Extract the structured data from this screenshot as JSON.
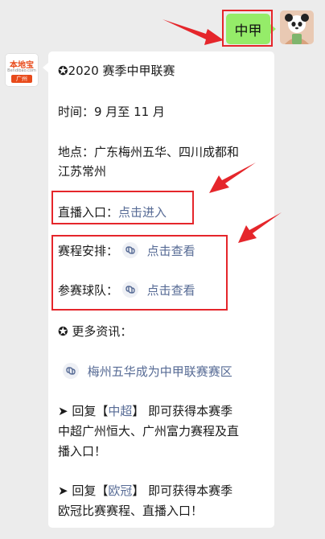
{
  "outgoing": {
    "text": "中甲"
  },
  "incoming": {
    "avatar": {
      "logo_text": "本地宝",
      "logo_sub": "Bendibao.com",
      "logo_city": "广州"
    },
    "title_star": "✪",
    "title": "2020 赛季中甲联赛",
    "time": "时间：9 月至 11 月",
    "place_line1": "地点：广东梅州五华、四川成都和",
    "place_line2": "江苏常州",
    "live_label": "直播入口：",
    "live_link": "点击进入",
    "schedule_label": "赛程安排：",
    "schedule_link": "点击查看",
    "teams_label": "参赛球队：",
    "teams_link": "点击查看",
    "more_star": "✪",
    "more_title": "更多资讯：",
    "more_link": "梅州五华成为中甲联赛赛区",
    "reply1_prefix": "➤ 回复【",
    "reply1_keyword": "中超",
    "reply1_suffix": "】 即可获得本赛季",
    "reply1_line2": "中超广州恒大、广州富力赛程及直",
    "reply1_line3": "播入口！",
    "reply2_prefix": "➤ 回复【",
    "reply2_keyword": "欧冠",
    "reply2_suffix": "】 即可获得本赛季",
    "reply2_line2": "欧冠比赛赛程、直播入口！"
  },
  "colors": {
    "highlight": "#e5262b",
    "link": "#576b95",
    "bubble_out": "#95ec69"
  }
}
